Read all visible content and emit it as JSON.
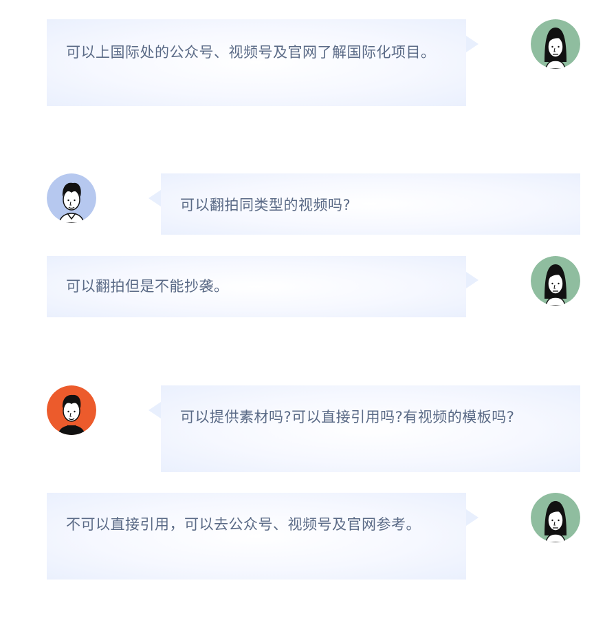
{
  "messages": [
    {
      "role": "answer",
      "text": "可以上国际处的公众号、视频号及官网了解国际化项目。",
      "avatar": "woman-avatar-icon"
    },
    {
      "role": "question",
      "text": "可以翻拍同类型的视频吗?",
      "avatar": "man-avatar-icon"
    },
    {
      "role": "answer",
      "text": "可以翻拍但是不能抄袭。",
      "avatar": "woman-avatar-icon"
    },
    {
      "role": "question",
      "text": "可以提供素材吗?可以直接引用吗?有视频的模板吗?",
      "avatar": "man-avatar-icon"
    },
    {
      "role": "answer",
      "text": "不可以直接引用，可以去公众号、视频号及官网参考。",
      "avatar": "woman-avatar-icon"
    }
  ],
  "colors": {
    "woman_avatar_bg": "#8fbd9f",
    "man_avatar_blue_bg": "#b6c8ef",
    "man_avatar_orange_bg": "#ec5b2c",
    "bubble_text": "#5a6a86",
    "bubble_bg": "#eef3fe"
  }
}
